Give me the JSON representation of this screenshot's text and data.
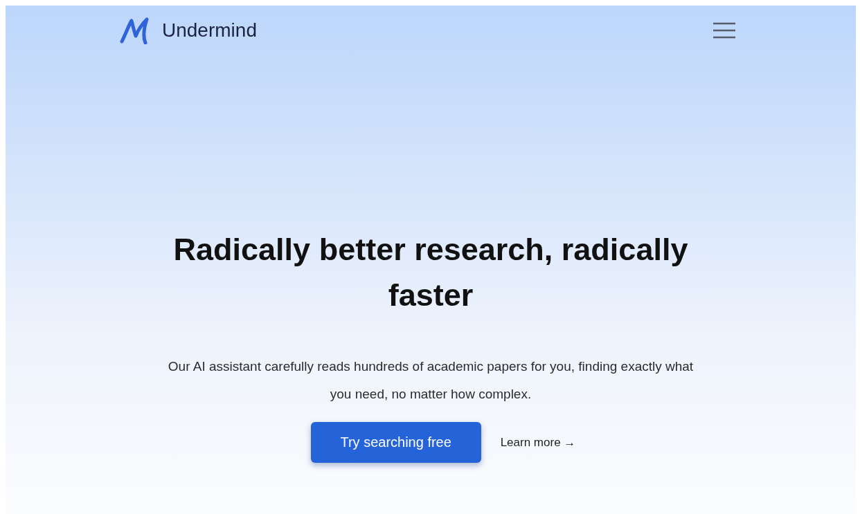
{
  "header": {
    "brand": "Undermind"
  },
  "hero": {
    "headline": "Radically better research, radically faster",
    "description": "Our AI assistant carefully reads hundreds of academic papers for you, finding exactly what you need, no matter how complex.",
    "primary_button": "Try searching free",
    "secondary_link": "Learn more →"
  }
}
